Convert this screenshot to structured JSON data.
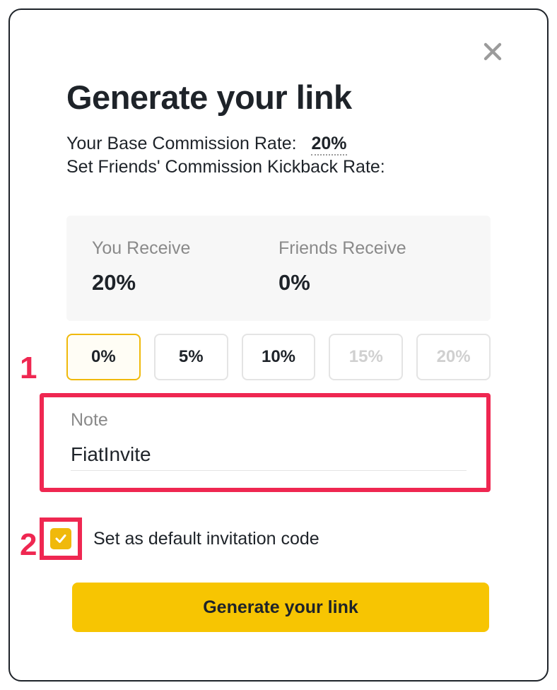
{
  "modal": {
    "title": "Generate your link",
    "base_rate_label": "Your Base Commission Rate:",
    "base_rate_value": "20%",
    "kickback_label": "Set Friends' Commission Kickback Rate:",
    "you_receive_label": "You Receive",
    "you_receive_value": "20%",
    "friends_receive_label": "Friends Receive",
    "friends_receive_value": "0%",
    "options": {
      "opt0": "0%",
      "opt1": "5%",
      "opt2": "10%",
      "opt3": "15%",
      "opt4": "20%"
    },
    "note_label": "Note",
    "note_value": "FiatInvite",
    "default_label": "Set as default invitation code",
    "generate_label": "Generate your link"
  },
  "annotations": {
    "one": "1",
    "two": "2"
  }
}
